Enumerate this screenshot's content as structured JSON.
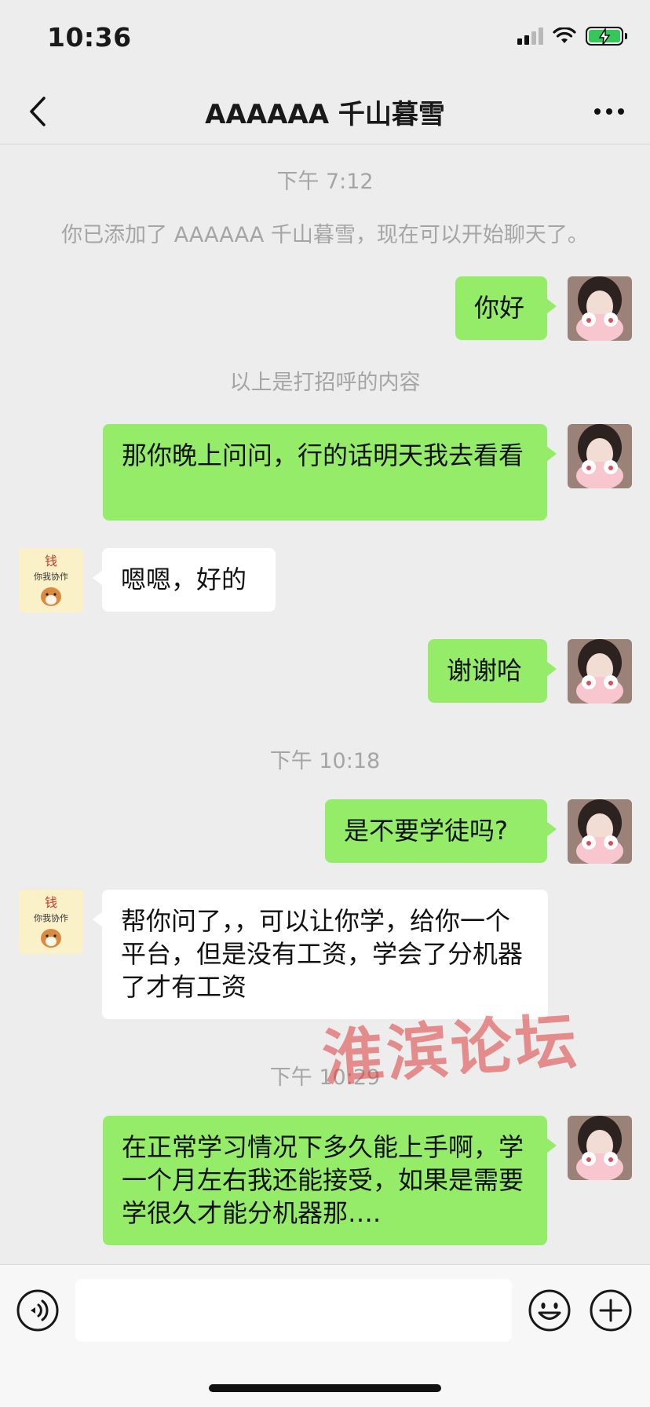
{
  "status_bar": {
    "time": "10:36",
    "icons": [
      "signal-icon",
      "wifi-icon",
      "battery-charging-icon"
    ]
  },
  "header": {
    "title": "AAAAAA 千山暮雪",
    "back_icon": "chevron-left-icon",
    "more_icon": "more-horizontal-icon"
  },
  "chat": {
    "time_1": "下午 7:12",
    "system_added": "你已添加了 AAAAAA 千山暮雪，现在可以开始聊天了。",
    "msg_1": "你好",
    "system_greeting": "以上是打招呼的内容",
    "msg_2": "那你晚上问问，行的话明天我去看看",
    "msg_3": "嗯嗯，好的",
    "msg_4": "谢谢哈",
    "time_2": "下午 10:18",
    "msg_5": "是不要学徒吗?",
    "msg_6": "帮你问了，，可以让你学，给你一个平台，但是没有工资，学会了分机器了才有工资",
    "time_3": "下午 10:29",
    "msg_7": "在正常学习情况下多久能上手啊，学一个月左右我还能接受，如果是需要学很久才能分机器那….",
    "contact_avatar_text_top": "钱",
    "contact_avatar_text_bottom": "你我协作"
  },
  "watermark": "淮滨论坛",
  "input_bar": {
    "placeholder": "",
    "voice_icon": "voice-icon",
    "emoji_icon": "emoji-icon",
    "plus_icon": "plus-circle-icon"
  },
  "colors": {
    "background": "#ededed",
    "my_bubble": "#95ec69",
    "their_bubble": "#ffffff",
    "system_text": "#a5a5a5"
  }
}
